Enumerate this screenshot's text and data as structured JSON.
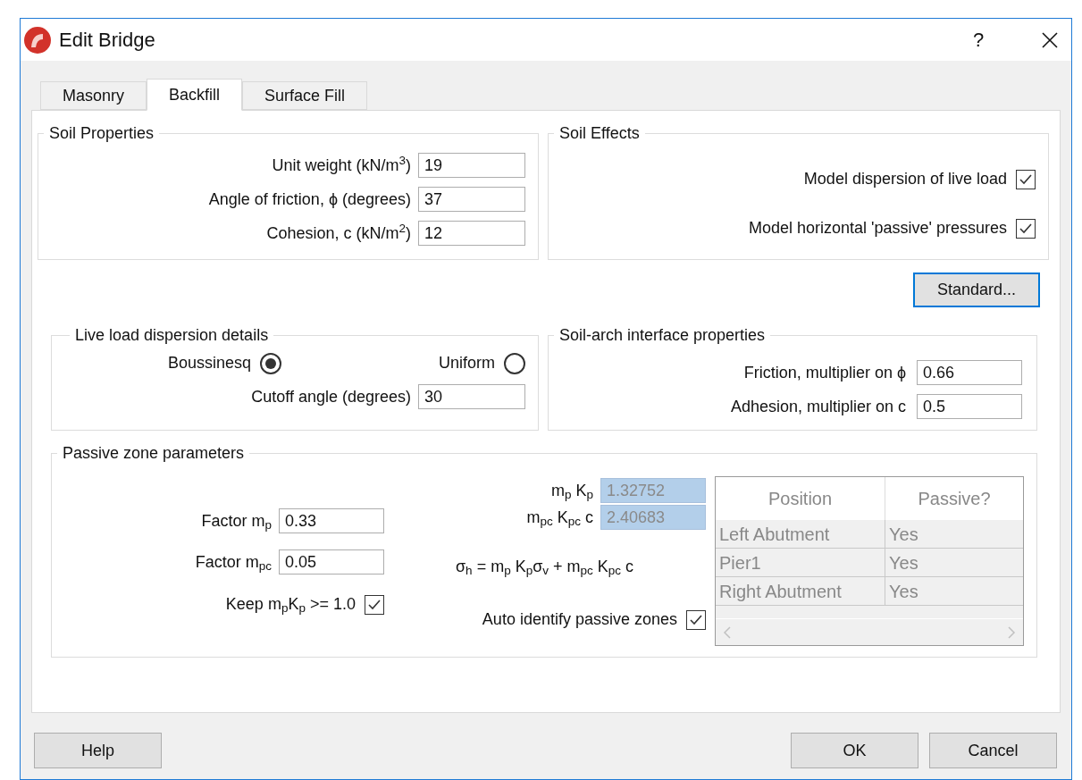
{
  "window": {
    "title": "Edit Bridge",
    "help": "?"
  },
  "tabs": [
    {
      "label": "Masonry",
      "selected": false
    },
    {
      "label": "Backfill",
      "selected": true
    },
    {
      "label": "Surface Fill",
      "selected": false
    }
  ],
  "soil_properties": {
    "title": "Soil Properties",
    "fields": [
      {
        "label": "Unit weight (kN/m$^{3}$)",
        "value": "19"
      },
      {
        "label": "Angle of friction, ϕ (degrees)",
        "value": "37"
      },
      {
        "label": "Cohesion, c (kN/m$^{2}$)",
        "value": "12"
      }
    ]
  },
  "soil_effects": {
    "title": "Soil Effects",
    "options": [
      {
        "label": "Model dispersion of live load",
        "checked": true
      },
      {
        "label": "Model horizontal 'passive' pressures",
        "checked": true
      }
    ]
  },
  "standard_button": "Standard...",
  "live_load": {
    "title": "Live load dispersion details",
    "radios": [
      {
        "label": "Boussinesq",
        "selected": true
      },
      {
        "label": "Uniform",
        "selected": false
      }
    ],
    "cutoff": {
      "label": "Cutoff angle (degrees)",
      "value": "30"
    }
  },
  "soil_arch": {
    "title": "Soil-arch interface properties",
    "fields": [
      {
        "label": "Friction, multiplier on ϕ",
        "value": "0.66"
      },
      {
        "label": "Adhesion, multiplier on c",
        "value": "0.5"
      }
    ]
  },
  "passive": {
    "title": "Passive zone parameters",
    "factors": [
      {
        "label": "Factor m$_{p}$",
        "value": "0.33"
      },
      {
        "label": "Factor m$_{pc}$",
        "value": "0.05"
      }
    ],
    "keep": {
      "label": "Keep m$_{p}$K$_{p}$ >= 1.0",
      "checked": true
    },
    "results": [
      {
        "label": "m$_{p}$ K$_{p}$",
        "value": "1.32752",
        "disabled": true
      },
      {
        "label": "m$_{pc}$ K$_{pc}$ c",
        "value": "2.40683",
        "disabled": true
      }
    ],
    "formula": "σ$_{h}$ = m$_{p}$ K$_{p}$σ$_{v}$ + m$_{pc}$ K$_{pc}$ c",
    "auto": {
      "label": "Auto identify passive zones",
      "checked": true
    },
    "table": {
      "columns": [
        "Position",
        "Passive?"
      ],
      "rows": [
        [
          "Left Abutment",
          "Yes"
        ],
        [
          "Pier1",
          "Yes"
        ],
        [
          "Right Abutment",
          "Yes"
        ]
      ]
    }
  },
  "buttons": {
    "help": "Help",
    "ok": "OK",
    "cancel": "Cancel"
  }
}
